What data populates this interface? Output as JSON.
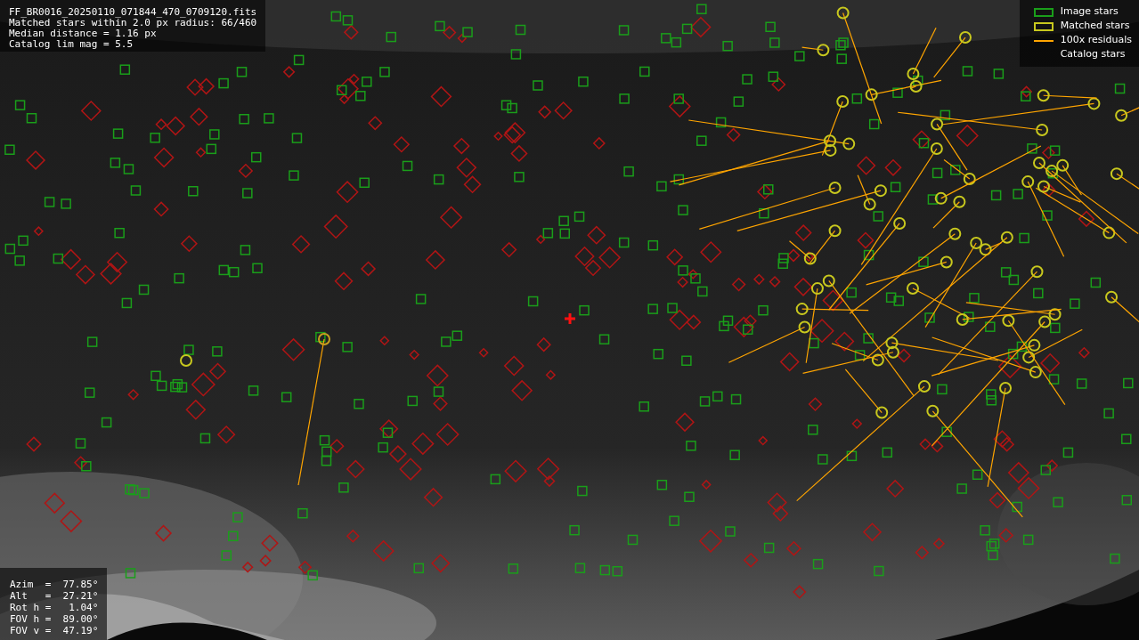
{
  "file_info": {
    "lines": [
      "FF_BR0016_20250110_071844_470_0709120.fits",
      "Matched stars within 2.0 px radius: 66/460",
      "Median distance = 1.16 px",
      "Catalog lim mag = 5.5"
    ]
  },
  "legend": [
    {
      "label": "Image stars",
      "kind": "box",
      "color": "#1a9e1a"
    },
    {
      "label": "Matched stars",
      "kind": "box",
      "color": "#c8c81e"
    },
    {
      "label": "100x residuals",
      "kind": "line",
      "color": "#ffa500"
    },
    {
      "label": "Catalog stars",
      "kind": "none"
    }
  ],
  "pointing": [
    "Azim  =  77.85°",
    "Alt   =  27.21°",
    "Rot h =   1.04°",
    "FOV h =  89.00°",
    "FOV v =  47.19°"
  ]
}
